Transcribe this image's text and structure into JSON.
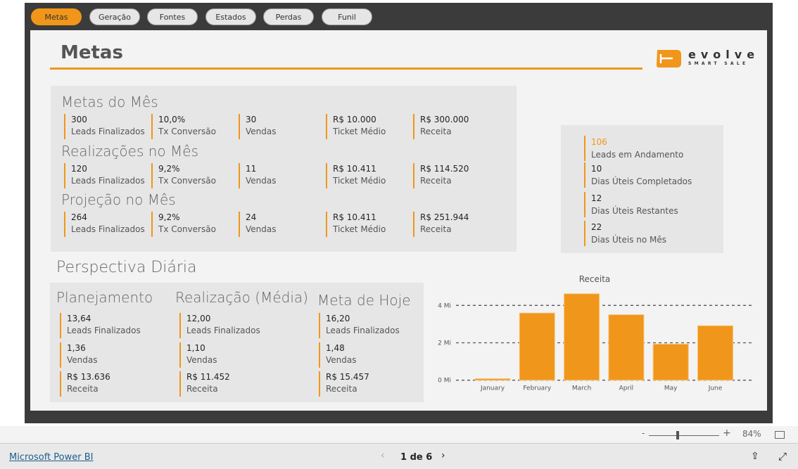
{
  "tabs": [
    "Metas",
    "Geração",
    "Fontes",
    "Estados",
    "Perdas",
    "Funil"
  ],
  "active_tab": "Metas",
  "page_title": "Metas",
  "logo": {
    "name": "evolve",
    "tagline": "SMART SALE"
  },
  "sections": [
    {
      "title": "Metas do Mês",
      "items": [
        {
          "v": "300",
          "l": "Leads Finalizados"
        },
        {
          "v": "10,0%",
          "l": "Tx Conversão"
        },
        {
          "v": "30",
          "l": "Vendas"
        },
        {
          "v": "R$ 10.000",
          "l": "Ticket Médio"
        },
        {
          "v": "R$ 300.000",
          "l": "Receita"
        }
      ]
    },
    {
      "title": "Realizações no Mês",
      "items": [
        {
          "v": "120",
          "l": "Leads Finalizados"
        },
        {
          "v": "9,2%",
          "l": "Tx Conversão"
        },
        {
          "v": "11",
          "l": "Vendas"
        },
        {
          "v": "R$ 10.411",
          "l": "Ticket Médio"
        },
        {
          "v": "R$ 114.520",
          "l": "Receita"
        }
      ]
    },
    {
      "title": "Projeção no Mês",
      "items": [
        {
          "v": "264",
          "l": "Leads Finalizados"
        },
        {
          "v": "9,2%",
          "l": "Tx Conversão"
        },
        {
          "v": "24",
          "l": "Vendas"
        },
        {
          "v": "R$ 10.411",
          "l": "Ticket Médio"
        },
        {
          "v": "R$ 251.944",
          "l": "Receita"
        }
      ]
    }
  ],
  "side": [
    {
      "v": "106",
      "l": "Leads em Andamento"
    },
    {
      "v": "10",
      "l": "Dias Úteis Completados"
    },
    {
      "v": "12",
      "l": "Dias Úteis Restantes"
    },
    {
      "v": "22",
      "l": "Dias Úteis no Mês"
    }
  ],
  "daily": {
    "title": "Perspectiva Diária",
    "columns": [
      {
        "title": "Planejamento",
        "items": [
          {
            "v": "13,64",
            "l": "Leads Finalizados"
          },
          {
            "v": "1,36",
            "l": "Vendas"
          },
          {
            "v": "R$ 13.636",
            "l": "Receita"
          }
        ]
      },
      {
        "title": "Realização (Média)",
        "items": [
          {
            "v": "12,00",
            "l": "Leads Finalizados"
          },
          {
            "v": "1,10",
            "l": "Vendas"
          },
          {
            "v": "R$ 11.452",
            "l": "Receita"
          }
        ]
      },
      {
        "title": "Meta de Hoje",
        "items": [
          {
            "v": "16,20",
            "l": "Leads Finalizados"
          },
          {
            "v": "1,48",
            "l": "Vendas"
          },
          {
            "v": "R$ 15.457",
            "l": "Receita"
          }
        ]
      }
    ]
  },
  "chart_data": {
    "type": "bar",
    "title": "Receita",
    "categories": [
      "January",
      "February",
      "March",
      "April",
      "May",
      "June"
    ],
    "values": [
      0.08,
      3.59,
      4.62,
      3.5,
      1.93,
      2.91
    ],
    "unit": "Mi",
    "yticks": [
      "0 Mi",
      "2 Mi",
      "4 Mi"
    ],
    "ylim": [
      0,
      4.7
    ],
    "grid": true,
    "color": "#f0961a"
  },
  "footer": {
    "zoom": "84%",
    "brand": "Microsoft Power BI",
    "page": "1 de 6"
  }
}
